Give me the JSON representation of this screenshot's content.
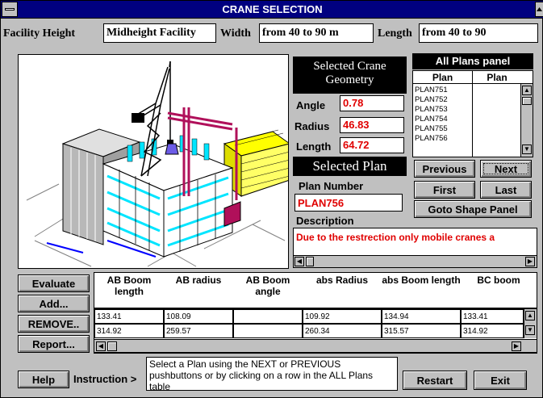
{
  "window": {
    "title": "CRANE SELECTION"
  },
  "header": {
    "facility_height_label": "Facility Height",
    "facility_height_value": "Midheight Facility",
    "width_label": "Width",
    "width_value": "from 40 to 90 m",
    "length_label": "Length",
    "length_value": "from 40 to 90"
  },
  "geometry": {
    "title_line1": "Selected Crane",
    "title_line2": "Geometry",
    "angle_label": "Angle",
    "angle_value": "0.78",
    "radius_label": "Radius",
    "radius_value": "46.83",
    "length_label": "Length",
    "length_value": "64.72"
  },
  "selected_plan": {
    "title": "Selected Plan",
    "plan_number_label": "Plan Number",
    "plan_number_value": "PLAN756",
    "description_label": "Description",
    "description_text": "Due to the restrection only mobile cranes a"
  },
  "all_plans": {
    "title": "All Plans panel",
    "col1": "Plan",
    "col2": "Plan",
    "items": [
      "PLAN751",
      "PLAN752",
      "PLAN753",
      "PLAN754",
      "PLAN755",
      "PLAN756"
    ]
  },
  "nav": {
    "previous": "Previous",
    "next": "Next",
    "first": "First",
    "last": "Last",
    "goto_shape": "Goto Shape Panel"
  },
  "left_buttons": {
    "evaluate": "Evaluate",
    "add": "Add...",
    "remove": "REMOVE..",
    "report": "Report..."
  },
  "table": {
    "headers": [
      "AB Boom length",
      "AB radius",
      "AB Boom angle",
      "abs Radius",
      "abs Boom length",
      "BC boom"
    ],
    "rows": [
      [
        "133.41",
        "108.09",
        "",
        "109.92",
        "134.94",
        "133.41"
      ],
      [
        "314.92",
        "259.57",
        "",
        "260.34",
        "315.57",
        "314.92"
      ]
    ]
  },
  "footer": {
    "help": "Help",
    "instruction_label": "Instruction >",
    "instruction_text": "Select a Plan using the NEXT or PREVIOUS pushbuttons or by clicking on a row in the ALL Plans table",
    "restart": "Restart",
    "exit": "Exit"
  },
  "colors": {
    "titlebar": "#000080",
    "panel": "#c0c0c0",
    "value_red": "#e00000",
    "building_cyan": "#00e5ff",
    "crane_magenta": "#b0105a",
    "highlight_yellow": "#ffff00"
  }
}
